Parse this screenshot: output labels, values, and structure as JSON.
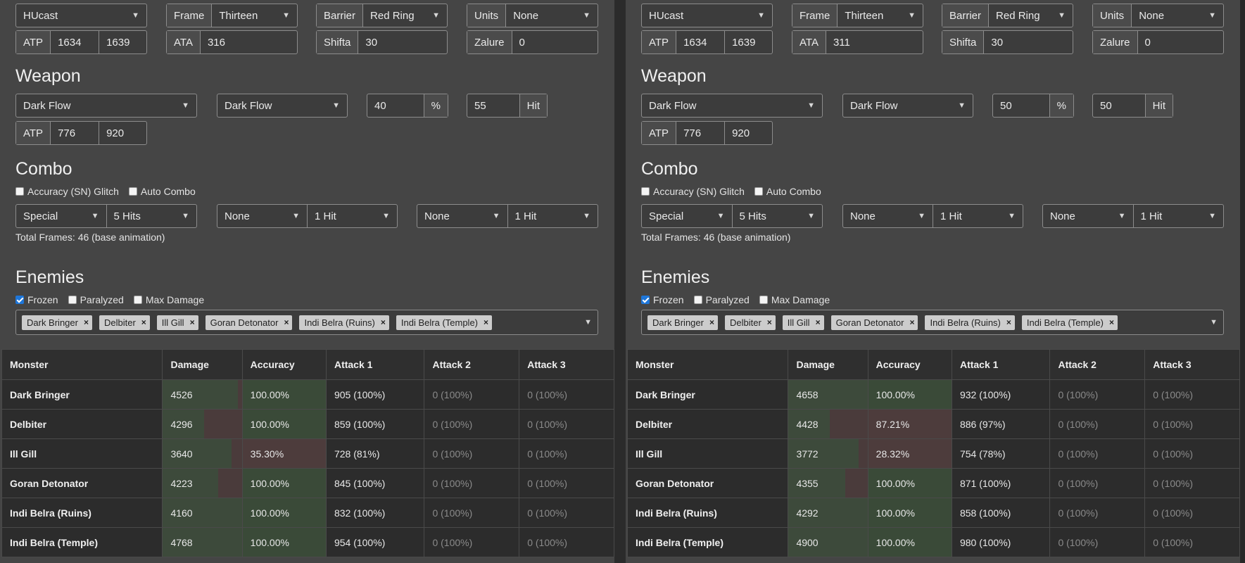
{
  "panels": [
    {
      "class_select": "HUcast",
      "frame": {
        "label": "Frame",
        "value": "Thirteen"
      },
      "barrier": {
        "label": "Barrier",
        "value": "Red Ring"
      },
      "units": {
        "label": "Units",
        "value": "None"
      },
      "atp": {
        "label": "ATP",
        "min": "1634",
        "max": "1639"
      },
      "ata": {
        "label": "ATA",
        "value": "316"
      },
      "shifta": {
        "label": "Shifta",
        "value": "30"
      },
      "zalure": {
        "label": "Zalure",
        "value": "0"
      },
      "weapon_heading": "Weapon",
      "weapon_select": "Dark Flow",
      "weapon_special": "Dark Flow",
      "weapon_percent": {
        "value": "40",
        "suffix": "%"
      },
      "weapon_hit": {
        "value": "55",
        "suffix": "Hit"
      },
      "weapon_atp": {
        "label": "ATP",
        "min": "776",
        "max": "920"
      },
      "combo_heading": "Combo",
      "accuracy_glitch": {
        "label": "Accuracy (SN) Glitch",
        "checked": false
      },
      "auto_combo": {
        "label": "Auto Combo",
        "checked": false
      },
      "combo": [
        {
          "attack": "Special",
          "hits": "5 Hits"
        },
        {
          "attack": "None",
          "hits": "1 Hit"
        },
        {
          "attack": "None",
          "hits": "1 Hit"
        }
      ],
      "total_frames": "Total Frames: 46 (base animation)",
      "enemies_heading": "Enemies",
      "frozen": {
        "label": "Frozen",
        "checked": true
      },
      "paralyzed": {
        "label": "Paralyzed",
        "checked": false
      },
      "max_damage": {
        "label": "Max Damage",
        "checked": false
      },
      "enemy_tags": [
        "Dark Bringer",
        "Delbiter",
        "Ill Gill",
        "Goran Detonator",
        "Indi Belra (Ruins)",
        "Indi Belra (Temple)"
      ],
      "table": {
        "headers": [
          "Monster",
          "Damage",
          "Accuracy",
          "Attack 1",
          "Attack 2",
          "Attack 3"
        ],
        "rows": [
          {
            "monster": "Dark Bringer",
            "damage": "4526",
            "damage_fill": 0.95,
            "accuracy": "100.00%",
            "accuracy_ok": true,
            "a1": "905 (100%)",
            "a2": "0 (100%)",
            "a3": "0 (100%)"
          },
          {
            "monster": "Delbiter",
            "damage": "4296",
            "damage_fill": 0.52,
            "accuracy": "100.00%",
            "accuracy_ok": true,
            "a1": "859 (100%)",
            "a2": "0 (100%)",
            "a3": "0 (100%)"
          },
          {
            "monster": "Ill Gill",
            "damage": "3640",
            "damage_fill": 0.87,
            "accuracy": "35.30%",
            "accuracy_ok": false,
            "a1": "728 (81%)",
            "a2": "0 (100%)",
            "a3": "0 (100%)"
          },
          {
            "monster": "Goran Detonator",
            "damage": "4223",
            "damage_fill": 0.7,
            "accuracy": "100.00%",
            "accuracy_ok": true,
            "a1": "845 (100%)",
            "a2": "0 (100%)",
            "a3": "0 (100%)"
          },
          {
            "monster": "Indi Belra (Ruins)",
            "damage": "4160",
            "damage_fill": 1.0,
            "accuracy": "100.00%",
            "accuracy_ok": true,
            "a1": "832 (100%)",
            "a2": "0 (100%)",
            "a3": "0 (100%)"
          },
          {
            "monster": "Indi Belra (Temple)",
            "damage": "4768",
            "damage_fill": 1.0,
            "accuracy": "100.00%",
            "accuracy_ok": true,
            "a1": "954 (100%)",
            "a2": "0 (100%)",
            "a3": "0 (100%)"
          }
        ]
      }
    },
    {
      "class_select": "HUcast",
      "frame": {
        "label": "Frame",
        "value": "Thirteen"
      },
      "barrier": {
        "label": "Barrier",
        "value": "Red Ring"
      },
      "units": {
        "label": "Units",
        "value": "None"
      },
      "atp": {
        "label": "ATP",
        "min": "1634",
        "max": "1639"
      },
      "ata": {
        "label": "ATA",
        "value": "311"
      },
      "shifta": {
        "label": "Shifta",
        "value": "30"
      },
      "zalure": {
        "label": "Zalure",
        "value": "0"
      },
      "weapon_heading": "Weapon",
      "weapon_select": "Dark Flow",
      "weapon_special": "Dark Flow",
      "weapon_percent": {
        "value": "50",
        "suffix": "%"
      },
      "weapon_hit": {
        "value": "50",
        "suffix": "Hit"
      },
      "weapon_atp": {
        "label": "ATP",
        "min": "776",
        "max": "920"
      },
      "combo_heading": "Combo",
      "accuracy_glitch": {
        "label": "Accuracy (SN) Glitch",
        "checked": false
      },
      "auto_combo": {
        "label": "Auto Combo",
        "checked": false
      },
      "combo": [
        {
          "attack": "Special",
          "hits": "5 Hits"
        },
        {
          "attack": "None",
          "hits": "1 Hit"
        },
        {
          "attack": "None",
          "hits": "1 Hit"
        }
      ],
      "total_frames": "Total Frames: 46 (base animation)",
      "enemies_heading": "Enemies",
      "frozen": {
        "label": "Frozen",
        "checked": true
      },
      "paralyzed": {
        "label": "Paralyzed",
        "checked": false
      },
      "max_damage": {
        "label": "Max Damage",
        "checked": false
      },
      "enemy_tags": [
        "Dark Bringer",
        "Delbiter",
        "Ill Gill",
        "Goran Detonator",
        "Indi Belra (Ruins)",
        "Indi Belra (Temple)"
      ],
      "table": {
        "headers": [
          "Monster",
          "Damage",
          "Accuracy",
          "Attack 1",
          "Attack 2",
          "Attack 3"
        ],
        "rows": [
          {
            "monster": "Dark Bringer",
            "damage": "4658",
            "damage_fill": 1.0,
            "accuracy": "100.00%",
            "accuracy_ok": true,
            "a1": "932 (100%)",
            "a2": "0 (100%)",
            "a3": "0 (100%)"
          },
          {
            "monster": "Delbiter",
            "damage": "4428",
            "damage_fill": 0.52,
            "accuracy": "87.21%",
            "accuracy_ok": false,
            "a1": "886 (97%)",
            "a2": "0 (100%)",
            "a3": "0 (100%)"
          },
          {
            "monster": "Ill Gill",
            "damage": "3772",
            "damage_fill": 0.89,
            "accuracy": "28.32%",
            "accuracy_ok": false,
            "a1": "754 (78%)",
            "a2": "0 (100%)",
            "a3": "0 (100%)"
          },
          {
            "monster": "Goran Detonator",
            "damage": "4355",
            "damage_fill": 0.72,
            "accuracy": "100.00%",
            "accuracy_ok": true,
            "a1": "871 (100%)",
            "a2": "0 (100%)",
            "a3": "0 (100%)"
          },
          {
            "monster": "Indi Belra (Ruins)",
            "damage": "4292",
            "damage_fill": 1.0,
            "accuracy": "100.00%",
            "accuracy_ok": true,
            "a1": "858 (100%)",
            "a2": "0 (100%)",
            "a3": "0 (100%)"
          },
          {
            "monster": "Indi Belra (Temple)",
            "damage": "4900",
            "damage_fill": 1.0,
            "accuracy": "100.00%",
            "accuracy_ok": true,
            "a1": "980 (100%)",
            "a2": "0 (100%)",
            "a3": "0 (100%)"
          }
        ]
      }
    }
  ],
  "icons": {
    "dropdown": "chevron-down-icon",
    "remove_tag": "close-icon",
    "checkbox": "checkbox-icon"
  }
}
